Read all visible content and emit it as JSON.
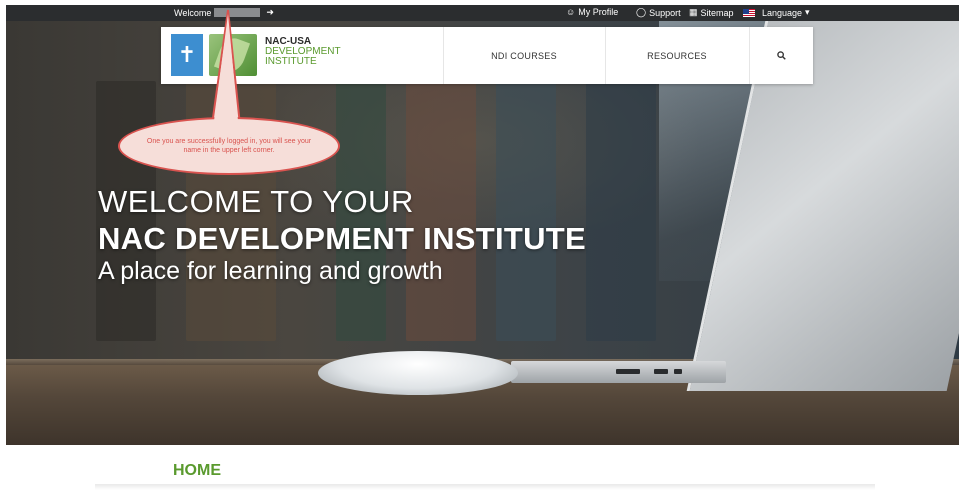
{
  "topbar": {
    "welcome_label": "Welcome",
    "logout_icon": "sign-out-icon",
    "links": [
      {
        "label": "My Profile",
        "icon": "user-icon"
      },
      {
        "label": "Support",
        "icon": "chat-bubble-icon"
      },
      {
        "label": "Sitemap",
        "icon": "sitemap-icon"
      },
      {
        "label": "Language",
        "icon": "us-flag-icon",
        "caret": "chevron-down-icon"
      }
    ]
  },
  "nav": {
    "logo": {
      "line1": "NAC-USA",
      "line2": "DEVELOPMENT",
      "line3": "INSTITUTE"
    },
    "items": [
      "NDI COURSES",
      "RESOURCES"
    ],
    "search_icon": "search-icon"
  },
  "callout": {
    "text": "One you are successfully logged in, you will see your name in the upper left corner."
  },
  "hero": {
    "line1": "WELCOME TO YOUR",
    "line2": "NAC DEVELOPMENT INSTITUTE",
    "line3": "A place for learning and growth"
  },
  "section": {
    "heading": "HOME"
  },
  "colors": {
    "accent_green": "#5a9a2e",
    "topbar_bg": "#2b2d2f",
    "callout_red": "#d9534f",
    "callout_fill": "#f6ded9"
  }
}
